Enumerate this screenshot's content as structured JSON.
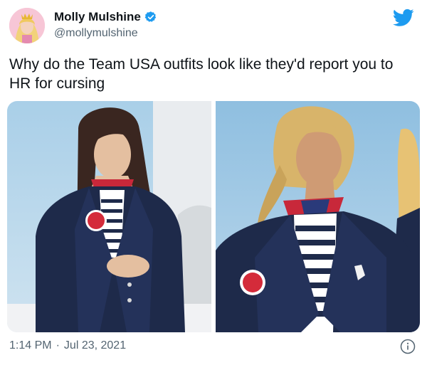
{
  "tweet": {
    "author": {
      "display_name": "Molly Mulshine",
      "handle": "@mollymulshine",
      "verified_icon": "verified-badge-icon"
    },
    "brand_icon": "twitter-bird-icon",
    "text": "Why do the Team USA outfits look like they'd report you to HR for cursing",
    "media": [
      {
        "alt": "Athlete in navy Team USA blazer with striped shirt and flag scarf"
      },
      {
        "alt": "Athlete in navy Team USA blazer with striped shirt and flag scarf, close-up"
      }
    ],
    "time": "1:14 PM",
    "separator": "·",
    "date": "Jul 23, 2021",
    "info_icon": "info-icon"
  },
  "colors": {
    "twitter_blue": "#1d9bf0",
    "text_primary": "#0f1419",
    "text_secondary": "#536471",
    "navy": "#1e2a4a"
  }
}
